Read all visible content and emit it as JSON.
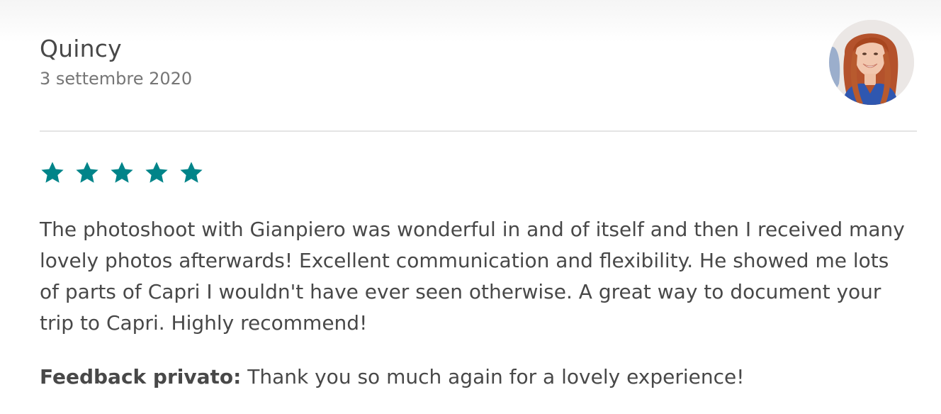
{
  "review": {
    "reviewer_name": "Quincy",
    "date": "3 settembre 2020",
    "rating": 5,
    "rating_max": 5,
    "star_color": "#008489",
    "text": "The photoshoot with Gianpiero was wonderful in and of itself and then I received many lovely photos afterwards! Excellent communication and flexibility. He showed me lots of parts of Capri I wouldn't have ever seen otherwise. A great way to document your trip to Capri. Highly recommend!",
    "private_feedback_label": "Feedback privato:",
    "private_feedback_text": " Thank you so much again for a lovely experience!"
  },
  "icons": {
    "avatar": "user-avatar-photo",
    "star": "star-icon"
  }
}
